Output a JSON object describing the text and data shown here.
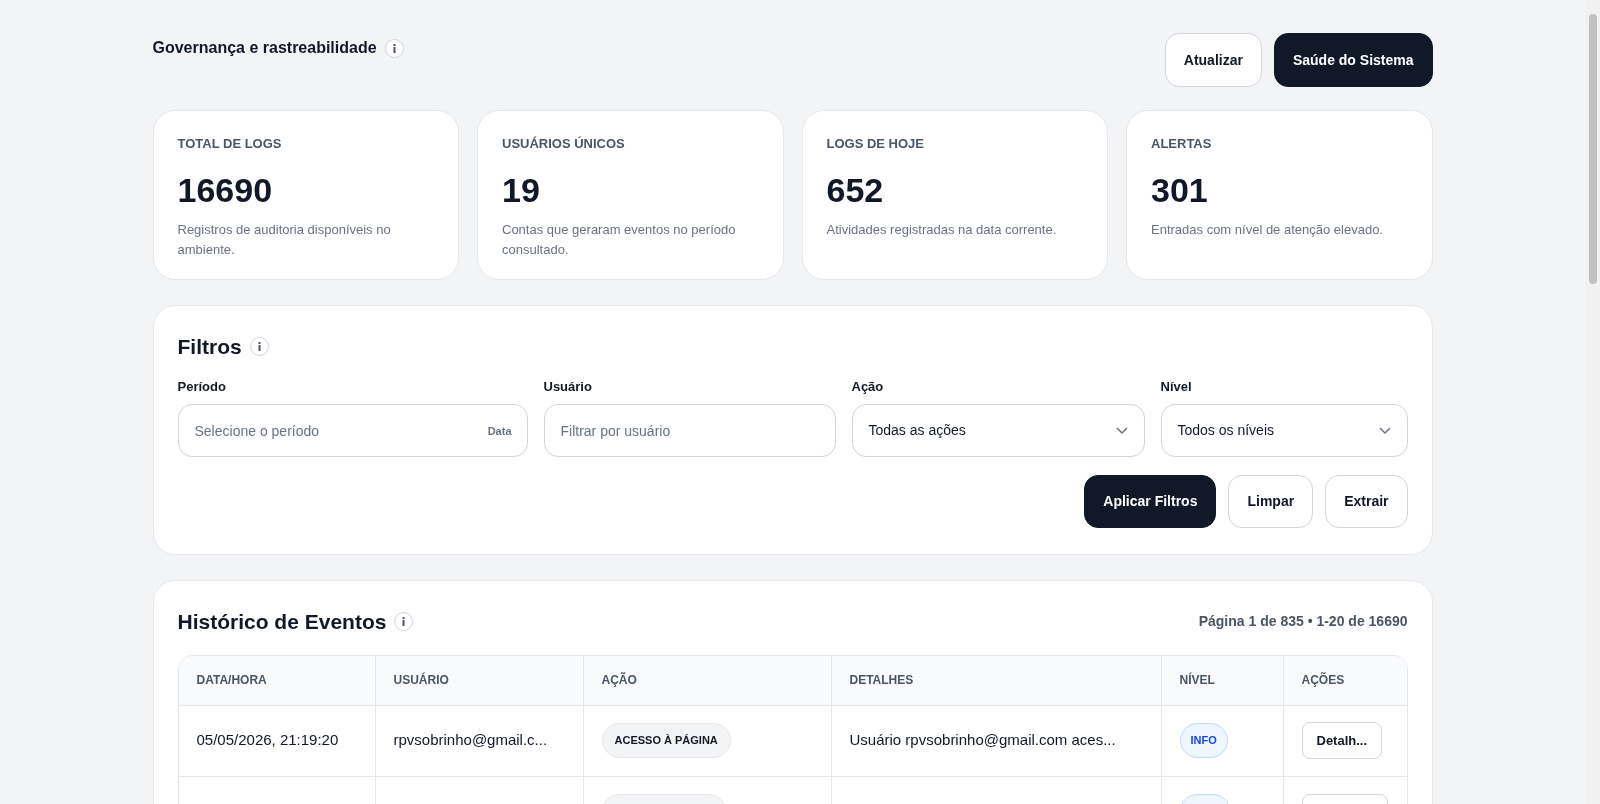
{
  "header": {
    "title": "Governança e rastreabilidade",
    "buttons": [
      {
        "label": "Atualizar",
        "kind": "outline"
      },
      {
        "label": "Saúde do Sistema",
        "kind": "primary"
      }
    ]
  },
  "stats": [
    {
      "label": "TOTAL DE LOGS",
      "value": "16690",
      "description": "Registros de auditoria disponíveis no ambiente."
    },
    {
      "label": "USUÁRIOS ÚNICOS",
      "value": "19",
      "description": "Contas que geraram eventos no período consultado."
    },
    {
      "label": "LOGS DE HOJE",
      "value": "652",
      "description": "Atividades registradas na data corrente."
    },
    {
      "label": "ALERTAS",
      "value": "301",
      "description": "Entradas com nível de atenção elevado."
    }
  ],
  "filters": {
    "title": "Filtros",
    "fields": [
      {
        "label": "Período",
        "kind": "date",
        "placeholder": "Selecione o período",
        "suffix": "Data"
      },
      {
        "label": "Usuário",
        "kind": "text",
        "placeholder": "Filtrar por usuário"
      },
      {
        "label": "Ação",
        "kind": "select",
        "value": "Todas as ações"
      },
      {
        "label": "Nível",
        "kind": "select",
        "value": "Todos os níveis"
      }
    ],
    "buttons": [
      {
        "label": "Aplicar Filtros",
        "kind": "primary"
      },
      {
        "label": "Limpar",
        "kind": "outline"
      },
      {
        "label": "Extrair",
        "kind": "outline"
      }
    ]
  },
  "history": {
    "title": "Histórico de Eventos",
    "pagination": "Página 1 de 835 • 1-20 de 16690",
    "columns": [
      "DATA/HORA",
      "USUÁRIO",
      "AÇÃO",
      "DETALHES",
      "NÍVEL",
      "AÇÕES"
    ],
    "rows": [
      {
        "datetime": "05/05/2026, 21:19:20",
        "user": "rpvsobrinho@gmail.c...",
        "action": "ACESSO À PÁGINA",
        "details": "Usuário rpvsobrinho@gmail.com aces...",
        "level": "INFO",
        "button": "Detalh..."
      }
    ]
  }
}
